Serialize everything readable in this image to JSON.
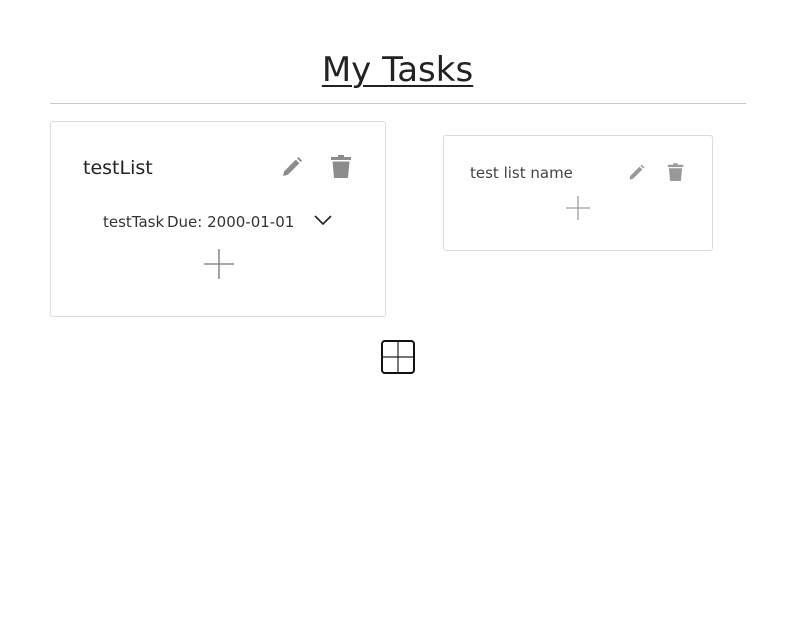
{
  "header": {
    "title": "My Tasks"
  },
  "lists": [
    {
      "name": "testList",
      "tasks": [
        {
          "name": "testTask",
          "due": "Due: 2000-01-01"
        }
      ]
    },
    {
      "name": "test list name",
      "tasks": []
    }
  ],
  "icons": {
    "edit": "pencil-icon",
    "delete": "trash-icon",
    "expand": "chevron-down-icon",
    "add_task": "plus-icon",
    "add_list": "plus-square-icon"
  },
  "colors": {
    "icon_gray": "#8c8c8c",
    "border": "#dcdcdc",
    "text": "#222222"
  }
}
